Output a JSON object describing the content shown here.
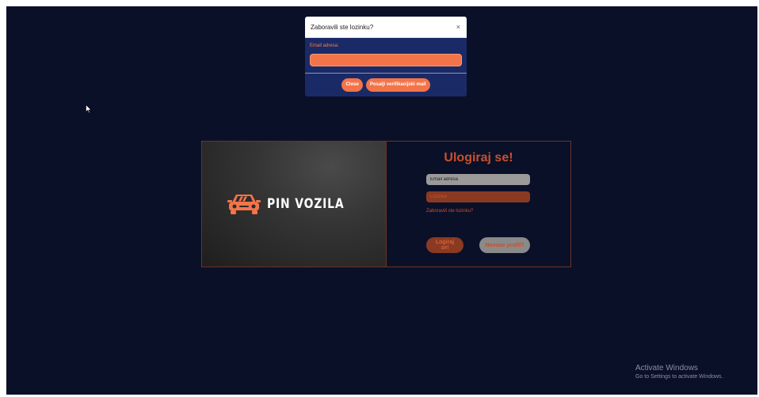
{
  "modal": {
    "title": "Zaboravili ste lozinku?",
    "close_symbol": "×",
    "email_label": "Email adresa:",
    "email_value": "",
    "close_button": "Close",
    "send_button": "Posalji verifikacijski mail"
  },
  "brand": {
    "name": "PIN VOZILA",
    "icon": "car-icon",
    "color": "#f47449"
  },
  "login": {
    "heading": "Ulogiraj se!",
    "email_placeholder": "Email adresa",
    "password_placeholder": "Lozinka",
    "forgot_link": "Zaboravili ste lozinku?",
    "login_button": "Logiraj se!",
    "no_profile_button": "Nemate profil?"
  },
  "watermark": {
    "line1": "Activate Windows",
    "line2": "Go to Settings to activate Windows."
  },
  "colors": {
    "background": "#0b1029",
    "accent": "#f47449",
    "modal_body": "#1a2a66"
  }
}
